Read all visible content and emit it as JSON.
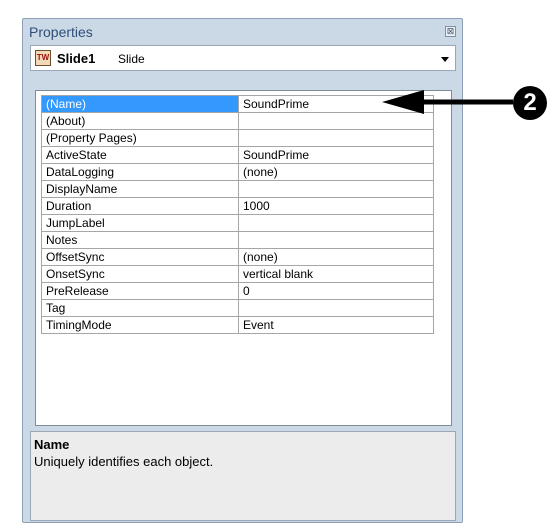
{
  "window": {
    "title": "Properties",
    "close_glyph": "⊠"
  },
  "object": {
    "icon": "slide-icon",
    "icon_text": "TW",
    "name": "Slide1",
    "type": "Slide"
  },
  "properties": [
    {
      "name": "(Name)",
      "value": "SoundPrime",
      "selected": true
    },
    {
      "name": "(About)",
      "value": ""
    },
    {
      "name": "(Property Pages)",
      "value": ""
    },
    {
      "name": "ActiveState",
      "value": "SoundPrime"
    },
    {
      "name": "DataLogging",
      "value": "(none)"
    },
    {
      "name": "DisplayName",
      "value": ""
    },
    {
      "name": "Duration",
      "value": "1000"
    },
    {
      "name": "JumpLabel",
      "value": ""
    },
    {
      "name": "Notes",
      "value": ""
    },
    {
      "name": "OffsetSync",
      "value": "(none)"
    },
    {
      "name": "OnsetSync",
      "value": "vertical blank"
    },
    {
      "name": "PreRelease",
      "value": "0"
    },
    {
      "name": "Tag",
      "value": ""
    },
    {
      "name": "TimingMode",
      "value": "Event"
    }
  ],
  "help": {
    "title": "Name",
    "description": "Uniquely identifies each object."
  },
  "callout": {
    "number": "2"
  },
  "colors": {
    "selection": "#3399ff",
    "window_bg": "#cbd8e6"
  }
}
